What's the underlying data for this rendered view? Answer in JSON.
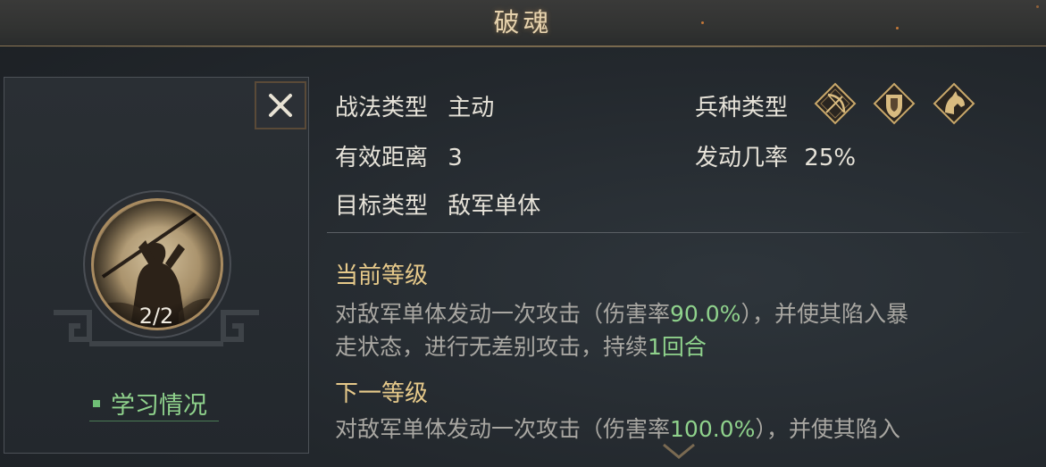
{
  "title": "破魂",
  "skill": {
    "level_display": "2/2",
    "study_label": "学习情况"
  },
  "attributes": {
    "tactic_type_label": "战法类型",
    "tactic_type_value": "主动",
    "effective_range_label": "有效距离",
    "effective_range_value": "3",
    "target_type_label": "目标类型",
    "target_type_value": "敌军单体",
    "troop_type_label": "兵种类型",
    "activation_rate_label": "发动几率",
    "activation_rate_value": "25%"
  },
  "troop_icons": [
    "archer-icon",
    "shield-infantry-icon",
    "cavalry-icon"
  ],
  "current_level": {
    "title": "当前等级",
    "line1_pre": "对敌军单体发动一次攻击（伤害率",
    "line1_hl": "90.0%",
    "line1_post": "），并使其陷入暴",
    "line2_pre": "走状态，进行无差别攻击，持续",
    "line2_hl": "1回合"
  },
  "next_level": {
    "title": "下一等级",
    "line1_pre": "对敌军单体发动一次攻击（伤害率",
    "line1_hl": "100.0%",
    "line1_post": "），并使其陷入"
  },
  "colors": {
    "accent_gold": "#e6c98a",
    "highlight_green": "#8fd28c",
    "description_gray": "#a9a7a2"
  }
}
